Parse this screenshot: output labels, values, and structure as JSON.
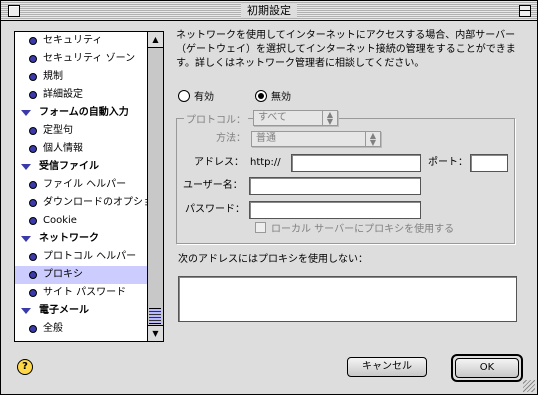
{
  "window": {
    "title": "初期設定"
  },
  "sidebar": {
    "items": [
      {
        "label": "セキュリティ",
        "kind": "sub",
        "icon": "bullet-icon"
      },
      {
        "label": "セキュリティ ゾーン",
        "kind": "sub",
        "icon": "bullet-icon"
      },
      {
        "label": "規制",
        "kind": "sub",
        "icon": "bullet-icon"
      },
      {
        "label": "詳細設定",
        "kind": "sub",
        "icon": "bullet-icon"
      },
      {
        "label": "フォームの自動入力",
        "kind": "cat",
        "icon": "disclosure-triangle-icon"
      },
      {
        "label": "定型句",
        "kind": "sub",
        "icon": "bullet-icon"
      },
      {
        "label": "個人情報",
        "kind": "sub",
        "icon": "bullet-icon"
      },
      {
        "label": "受信ファイル",
        "kind": "cat",
        "icon": "disclosure-triangle-icon"
      },
      {
        "label": "ファイル ヘルパー",
        "kind": "sub",
        "icon": "bullet-icon"
      },
      {
        "label": "ダウンロードのオプション",
        "kind": "sub",
        "icon": "bullet-icon"
      },
      {
        "label": "Cookie",
        "kind": "sub",
        "icon": "bullet-icon"
      },
      {
        "label": "ネットワーク",
        "kind": "cat",
        "icon": "disclosure-triangle-icon"
      },
      {
        "label": "プロトコル ヘルパー",
        "kind": "sub",
        "icon": "bullet-icon"
      },
      {
        "label": "プロキシ",
        "kind": "sub",
        "icon": "bullet-icon",
        "selected": true
      },
      {
        "label": "サイト パスワード",
        "kind": "sub",
        "icon": "bullet-icon"
      },
      {
        "label": "電子メール",
        "kind": "cat",
        "icon": "disclosure-triangle-icon"
      },
      {
        "label": "全般",
        "kind": "sub",
        "icon": "bullet-icon"
      }
    ]
  },
  "proxy": {
    "description": "ネットワークを使用してインターネットにアクセスする場合、内部サーバー（ゲートウェイ）を選択してインターネット接続の管理をすることができます。詳しくはネットワーク管理者に相談してください。",
    "enable_label": "有効",
    "disable_label": "無効",
    "selected": "無効",
    "protocol_label": "プロトコル：",
    "protocol_value": "すべて",
    "method_label": "方法：",
    "method_value": "普通",
    "address_label": "アドレス：",
    "address_prefix": "http://",
    "address_value": "",
    "port_label": "ポート：",
    "port_value": "",
    "username_label": "ユーザー名：",
    "username_value": "",
    "password_label": "パスワード：",
    "password_value": "",
    "local_checkbox_label": "ローカル サーバーにプロキシを使用する",
    "noproxy_label": "次のアドレスにはプロキシを使用しない：",
    "noproxy_value": ""
  },
  "buttons": {
    "cancel": "キャンセル",
    "ok": "OK",
    "help": "?"
  }
}
